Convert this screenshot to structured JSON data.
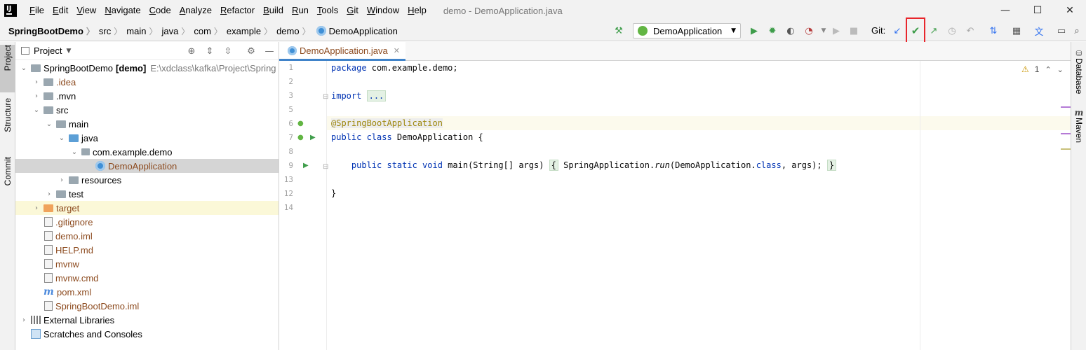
{
  "menu": {
    "items": [
      "File",
      "Edit",
      "View",
      "Navigate",
      "Code",
      "Analyze",
      "Refactor",
      "Build",
      "Run",
      "Tools",
      "Git",
      "Window",
      "Help"
    ],
    "window_title": "demo - DemoApplication.java"
  },
  "window_controls": {
    "minimize": "—",
    "maximize": "☐",
    "close": "✕"
  },
  "breadcrumb": [
    "SpringBootDemo",
    "src",
    "main",
    "java",
    "com",
    "example",
    "demo",
    "DemoApplication"
  ],
  "toolbar": {
    "run_config": "DemoApplication",
    "git_label": "Git:",
    "git_commit_highlighted": true,
    "colors": {
      "run": "#3f9d4b",
      "debug": "#3f9d4b",
      "git_update": "#3574f0",
      "git_commit": "#3f9d4b",
      "annotation": "#e8262c"
    }
  },
  "left_strip": {
    "tabs": [
      "Project",
      "Structure",
      "Commit"
    ]
  },
  "right_strip": {
    "tabs": [
      "Database",
      "Maven"
    ]
  },
  "project_panel": {
    "title": "Project",
    "tree": [
      {
        "label": "SpringBootDemo",
        "tag": "[demo]",
        "path": "E:\\xdclass\\kafka\\Project\\Spring",
        "icon": "folder-icon",
        "expanded": true
      },
      {
        "label": ".idea",
        "icon": "folder-icon",
        "expanded": false
      },
      {
        "label": ".mvn",
        "icon": "folder-icon",
        "expanded": false
      },
      {
        "label": "src",
        "icon": "folder-icon",
        "expanded": true
      },
      {
        "label": "main",
        "icon": "folder-icon",
        "expanded": true
      },
      {
        "label": "java",
        "icon": "source-folder-icon",
        "expanded": true
      },
      {
        "label": "com.example.demo",
        "icon": "package-icon",
        "expanded": true
      },
      {
        "label": "DemoApplication",
        "icon": "spring-class-icon",
        "selected": true
      },
      {
        "label": "resources",
        "icon": "resources-folder-icon",
        "expanded": false
      },
      {
        "label": "test",
        "icon": "folder-icon",
        "expanded": false
      },
      {
        "label": "target",
        "icon": "excluded-folder-icon",
        "expanded": false
      },
      {
        "label": ".gitignore",
        "icon": "file-icon"
      },
      {
        "label": "demo.iml",
        "icon": "iml-file-icon"
      },
      {
        "label": "HELP.md",
        "icon": "markdown-file-icon"
      },
      {
        "label": "mvnw",
        "icon": "script-file-icon"
      },
      {
        "label": "mvnw.cmd",
        "icon": "file-icon"
      },
      {
        "label": "pom.xml",
        "icon": "maven-icon"
      },
      {
        "label": "SpringBootDemo.iml",
        "icon": "iml-file-icon"
      },
      {
        "label": "External Libraries",
        "icon": "library-icon",
        "expanded": false
      },
      {
        "label": "Scratches and Consoles",
        "icon": "scratch-icon"
      }
    ]
  },
  "editor": {
    "tab": "DemoApplication.java",
    "inspection_count": "1",
    "line_numbers": [
      "1",
      "2",
      "3",
      "5",
      "6",
      "7",
      "8",
      "9",
      "13",
      "12",
      "14"
    ],
    "code": {
      "l1_kw": "package",
      "l1_rest": " com.example.demo;",
      "l3_kw": "import",
      "l3_fold": "...",
      "l6_ann": "@SpringBootApplication",
      "l7_kw": "public class",
      "l7_rest": " DemoApplication {",
      "l9_kw": "    public static void",
      "l9_a": " main(String[] args) ",
      "l9_b": "{",
      "l9_c": " SpringApplication.",
      "l9_run": "run",
      "l9_d": "(DemoApplication.",
      "l9_class": "class",
      "l9_e": ", args); ",
      "l9_f": "}",
      "l13": "}"
    }
  }
}
